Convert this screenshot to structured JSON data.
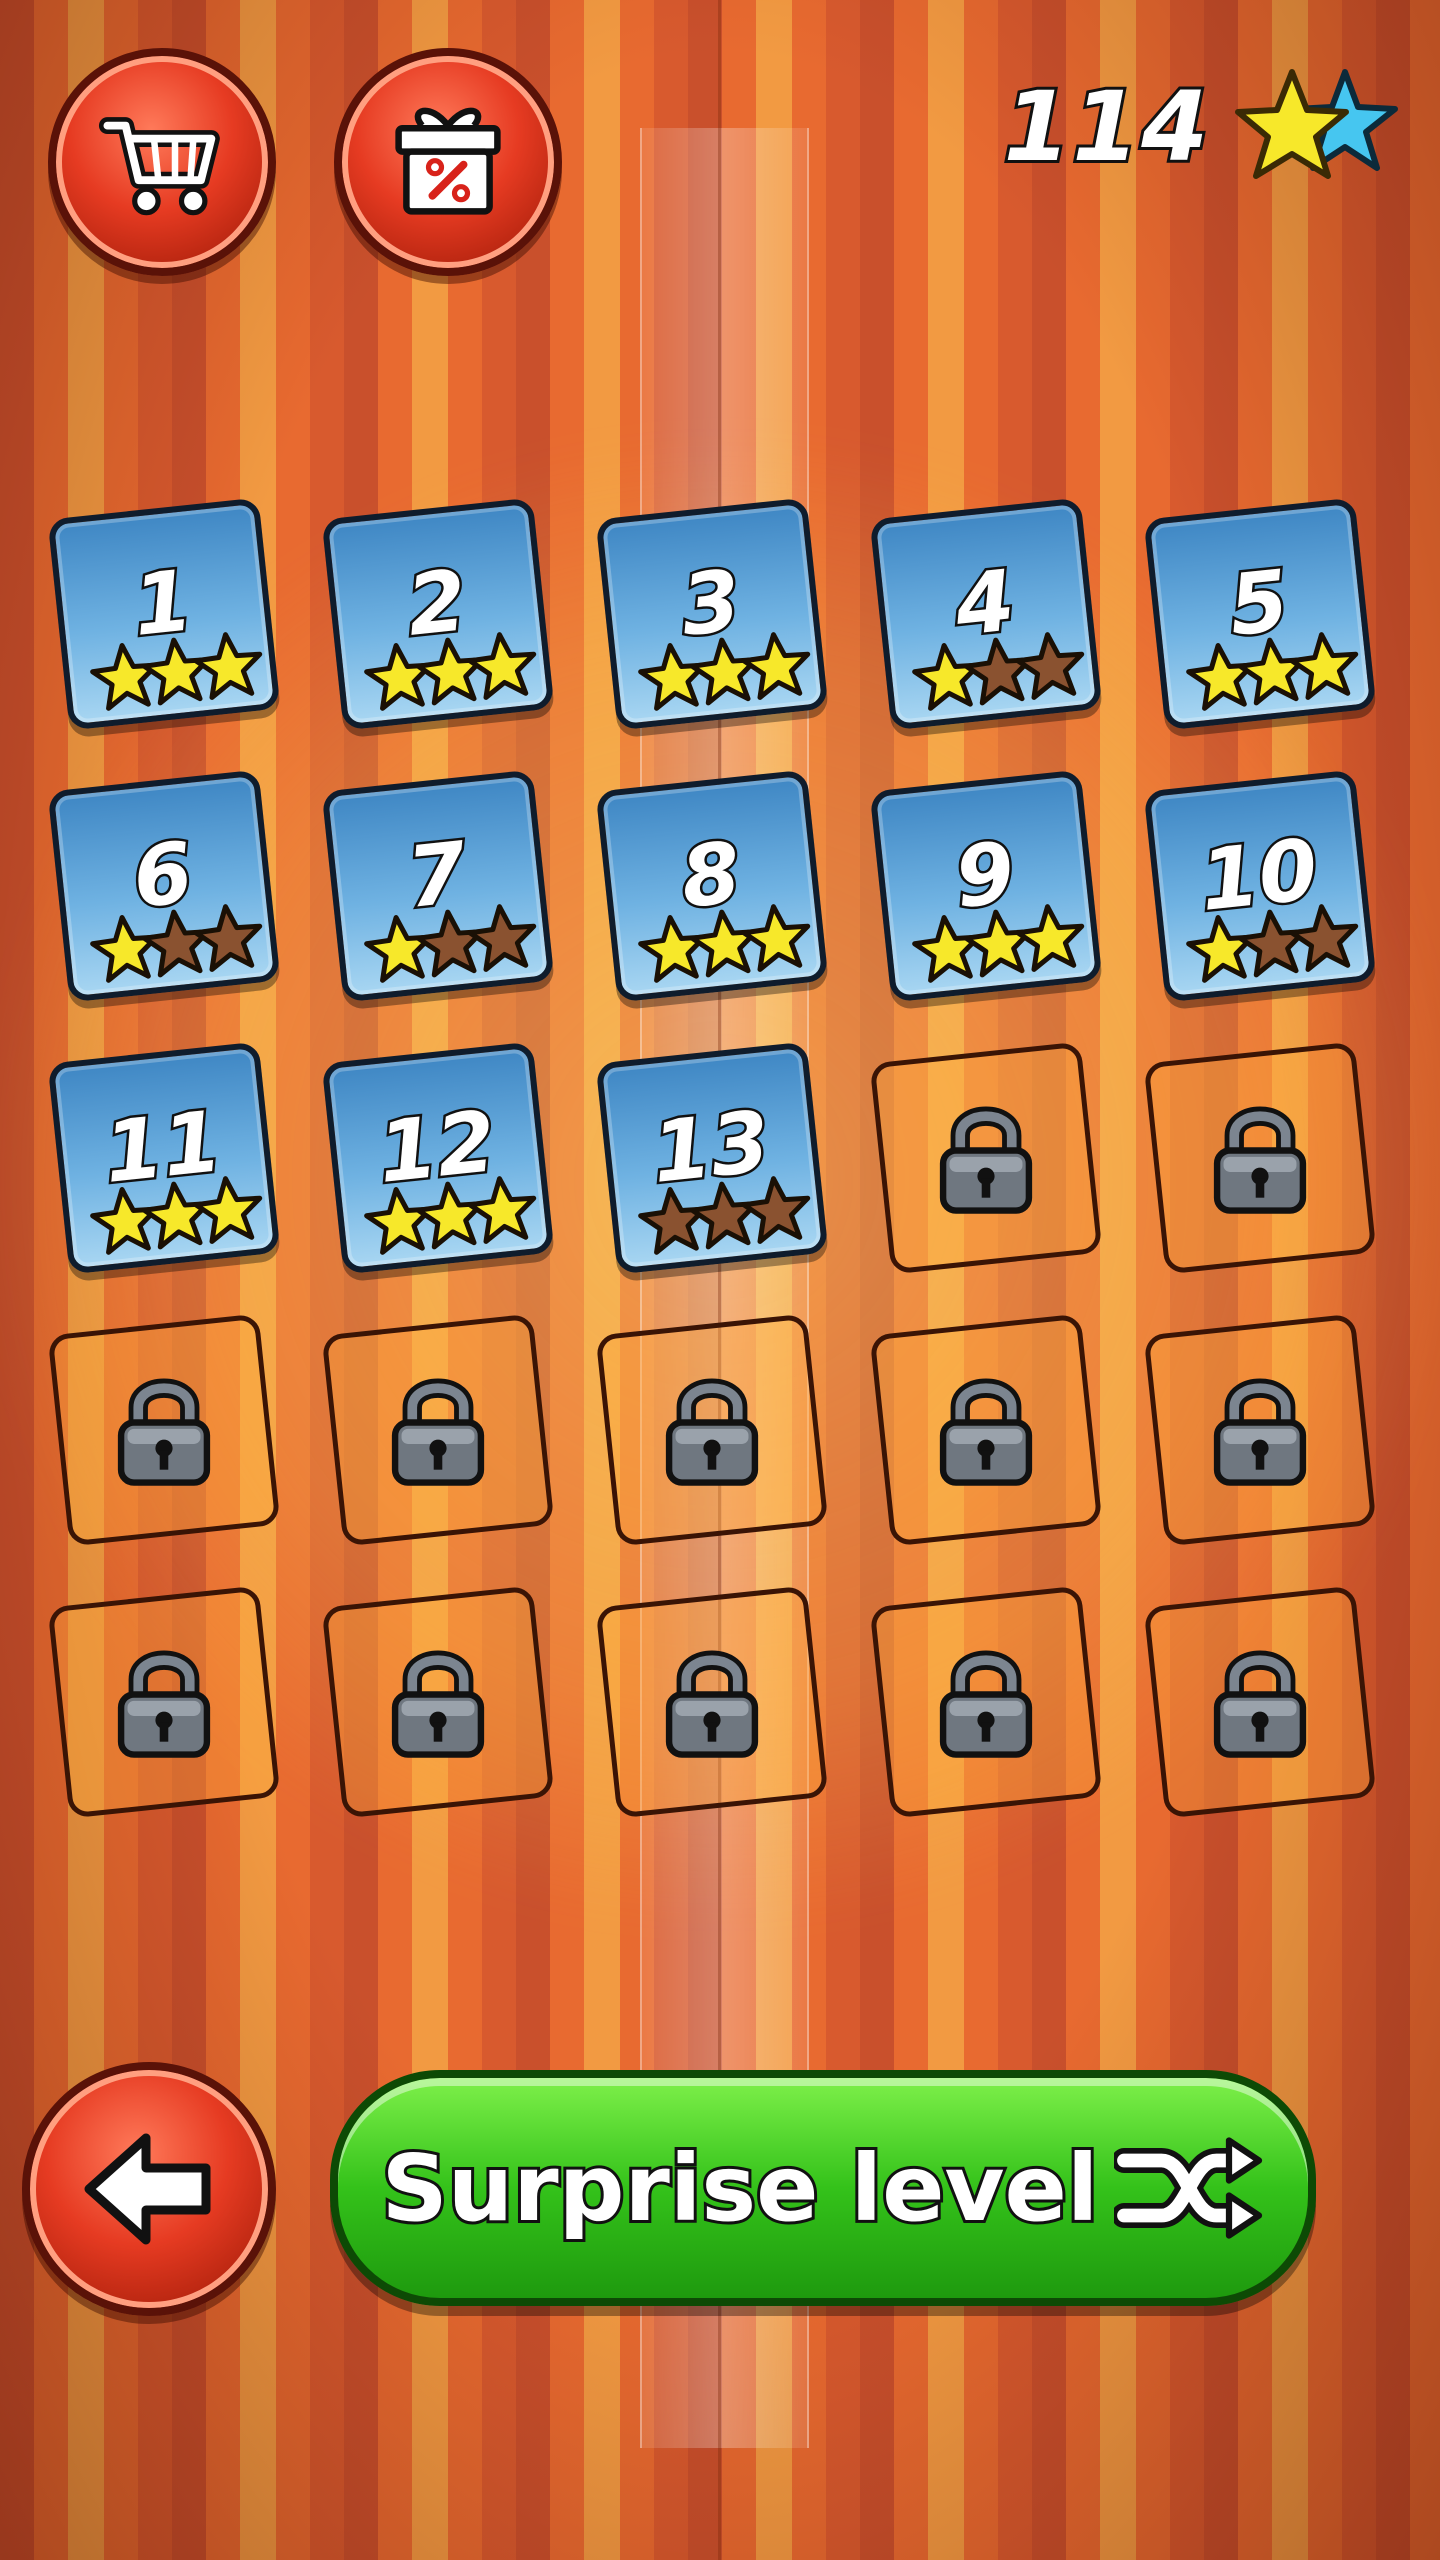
{
  "header": {
    "shop_icon": "shopping-cart-icon",
    "offer_icon": "gift-discount-icon",
    "stars_total": "114",
    "stars_icon": "double-star-icon"
  },
  "levels": [
    {
      "label": "1",
      "locked": false,
      "stars": 3
    },
    {
      "label": "2",
      "locked": false,
      "stars": 3
    },
    {
      "label": "3",
      "locked": false,
      "stars": 3
    },
    {
      "label": "4",
      "locked": false,
      "stars": 1
    },
    {
      "label": "5",
      "locked": false,
      "stars": 3
    },
    {
      "label": "6",
      "locked": false,
      "stars": 1
    },
    {
      "label": "7",
      "locked": false,
      "stars": 1
    },
    {
      "label": "8",
      "locked": false,
      "stars": 3
    },
    {
      "label": "9",
      "locked": false,
      "stars": 3
    },
    {
      "label": "10",
      "locked": false,
      "stars": 1
    },
    {
      "label": "11",
      "locked": false,
      "stars": 3
    },
    {
      "label": "12",
      "locked": false,
      "stars": 3
    },
    {
      "label": "13",
      "locked": false,
      "stars": 0
    },
    {
      "label": "",
      "locked": true,
      "stars": 0
    },
    {
      "label": "",
      "locked": true,
      "stars": 0
    },
    {
      "label": "",
      "locked": true,
      "stars": 0
    },
    {
      "label": "",
      "locked": true,
      "stars": 0
    },
    {
      "label": "",
      "locked": true,
      "stars": 0
    },
    {
      "label": "",
      "locked": true,
      "stars": 0
    },
    {
      "label": "",
      "locked": true,
      "stars": 0
    },
    {
      "label": "",
      "locked": true,
      "stars": 0
    },
    {
      "label": "",
      "locked": true,
      "stars": 0
    },
    {
      "label": "",
      "locked": true,
      "stars": 0
    },
    {
      "label": "",
      "locked": true,
      "stars": 0
    },
    {
      "label": "",
      "locked": true,
      "stars": 0
    }
  ],
  "footer": {
    "back_icon": "back-arrow-icon",
    "surprise_label": "Surprise level",
    "surprise_icon": "shuffle-icon"
  },
  "colors": {
    "star_earned": "#f7e82a",
    "star_empty": "#8a5230",
    "tile_blue": "#4a90cf",
    "button_red": "#e63b22",
    "button_green": "#34c21a"
  }
}
